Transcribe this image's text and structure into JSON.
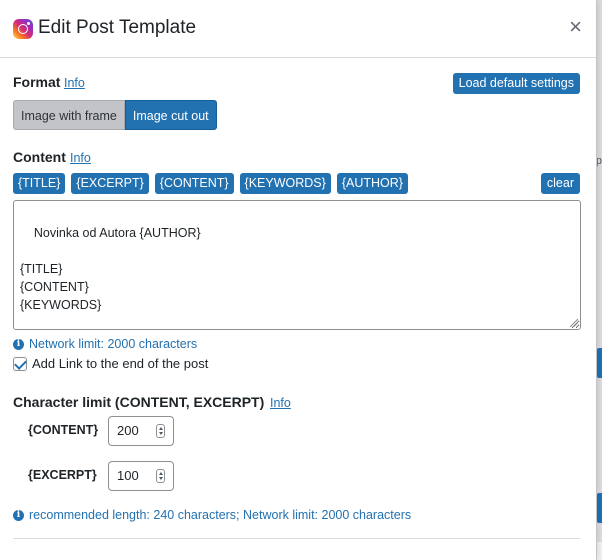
{
  "modal": {
    "title": "Edit Post Template",
    "close_glyph": "×",
    "icon": "instagram-icon"
  },
  "format": {
    "label": "Format",
    "info": "Info",
    "load_default": "Load default settings",
    "options": [
      "Image with frame",
      "Image cut out"
    ],
    "selected": "Image cut out"
  },
  "content": {
    "label": "Content",
    "info": "Info",
    "tags": [
      "{TITLE}",
      "{EXCERPT}",
      "{CONTENT}",
      "{KEYWORDS}",
      "{AUTHOR}"
    ],
    "clear": "clear",
    "value": "Novinka od Autora {AUTHOR}\n\n{TITLE}\n{CONTENT}\n{KEYWORDS}",
    "network_limit_note": "Network limit: 2000 characters"
  },
  "add_link": {
    "label": "Add Link to the end of the post",
    "checked": true
  },
  "char_limit": {
    "label": "Character limit (CONTENT, EXCERPT)",
    "info": "Info",
    "content_label": "{CONTENT}",
    "content_value": "200",
    "excerpt_label": "{EXCERPT}",
    "excerpt_value": "100",
    "recommendation": "recommended length: 240 characters; Network limit: 2000 characters"
  },
  "colors": {
    "primary": "#2271b1",
    "toggle_off": "#c3c4c7"
  }
}
